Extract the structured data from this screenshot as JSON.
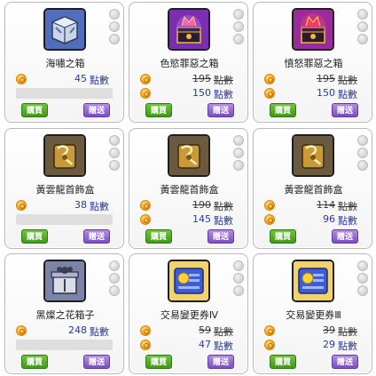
{
  "buttons": {
    "buy": "購買",
    "gift": "贈送"
  },
  "colors": {
    "buy": "#4aa81f",
    "gift": "#8a5cc9",
    "price": "#2a3b9a"
  },
  "items": [
    {
      "name": "海嘯之箱",
      "icon": "silver-blue-box-icon",
      "old_price": null,
      "price": "45",
      "unit": "點數"
    },
    {
      "name": "色慾罪惡之箱",
      "icon": "purple-sin-box-icon",
      "old_price": "195",
      "price": "150",
      "unit": "點數"
    },
    {
      "name": "憤怒罪惡之箱",
      "icon": "magenta-sin-box-icon",
      "old_price": "195",
      "price": "150",
      "unit": "點數"
    },
    {
      "name": "黃雲龍首飾盒",
      "icon": "golden-dragon-jewelry-box-icon",
      "old_price": null,
      "price": "38",
      "unit": "點數"
    },
    {
      "name": "黃雲龍首飾盒",
      "icon": "golden-dragon-jewelry-box-icon",
      "old_price": "190",
      "price": "145",
      "unit": "點數"
    },
    {
      "name": "黃雲龍首飾盒",
      "icon": "golden-dragon-jewelry-box-icon",
      "old_price": "114",
      "price": "96",
      "unit": "點數"
    },
    {
      "name": "黑燦之花箱子",
      "icon": "black-flower-box-icon",
      "old_price": null,
      "price": "248",
      "unit": "點數"
    },
    {
      "name": "交易變更券Ⅳ",
      "icon": "trade-ticket-icon",
      "old_price": "59",
      "price": "47",
      "unit": "點數"
    },
    {
      "name": "交易變更券Ⅲ",
      "icon": "trade-ticket-icon",
      "old_price": "39",
      "price": "29",
      "unit": "點數"
    }
  ]
}
